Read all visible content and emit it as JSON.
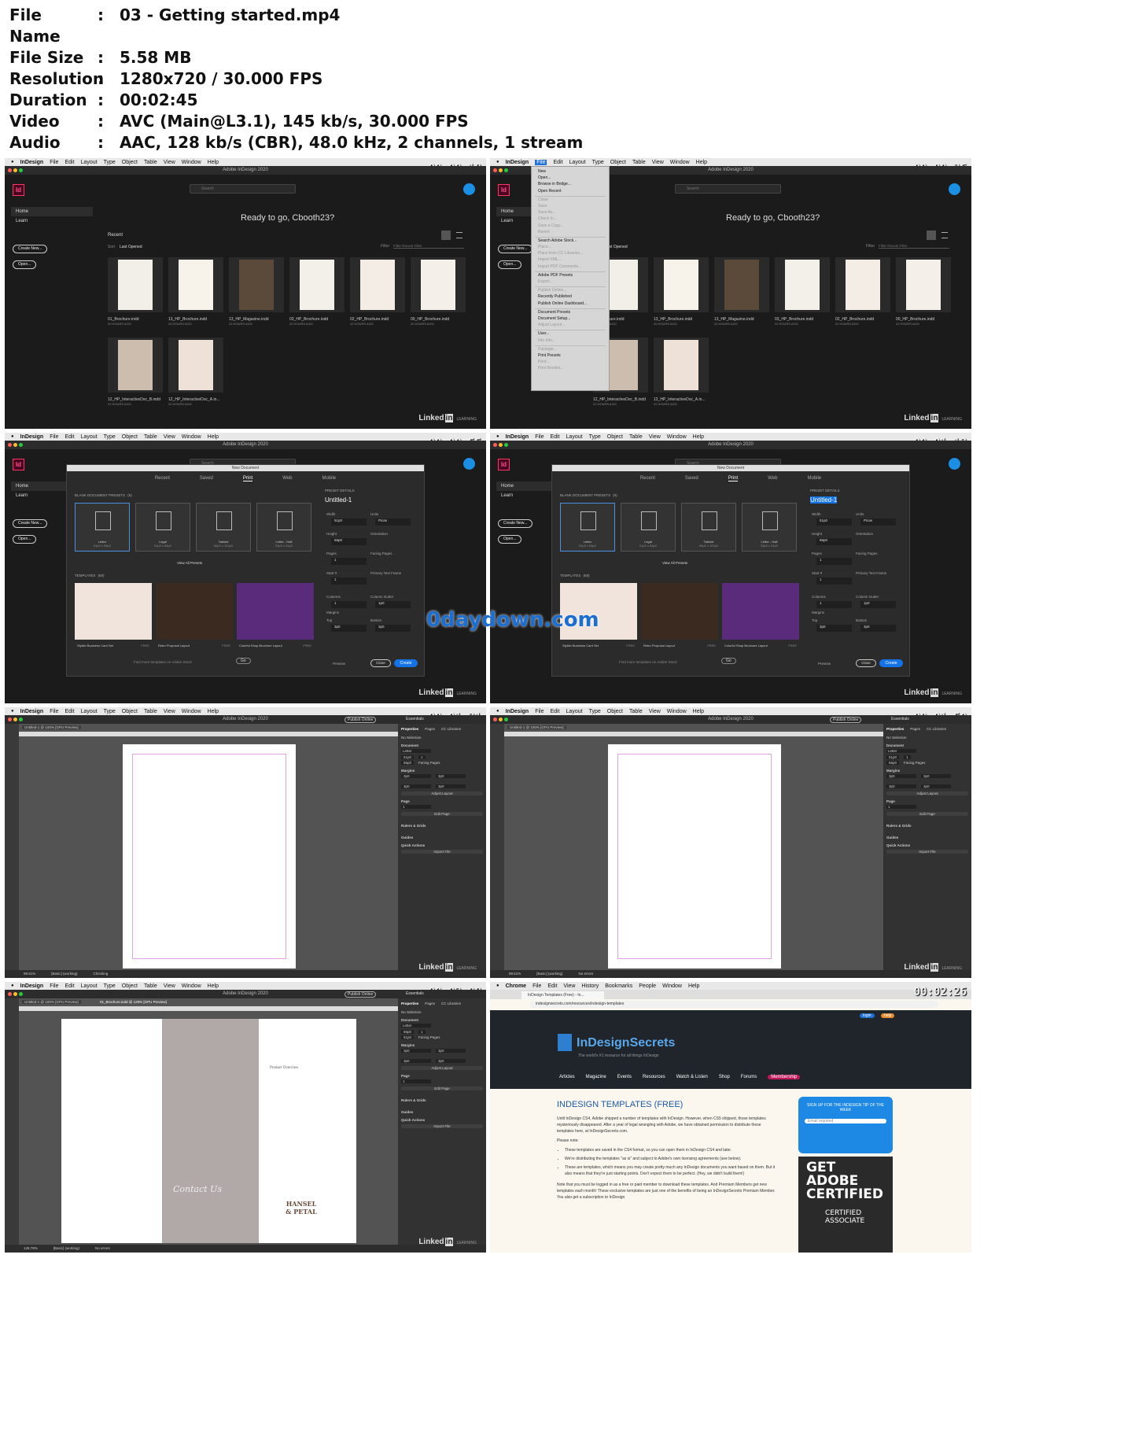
{
  "meta": [
    {
      "key": "File Name",
      "value": "03 - Getting started.mp4"
    },
    {
      "key": "File Size",
      "value": "5.58 MB"
    },
    {
      "key": "Resolution",
      "value": "1280x720 / 30.000 FPS"
    },
    {
      "key": "Duration",
      "value": "00:02:45"
    },
    {
      "key": "Video",
      "value": "AVC (Main@L3.1), 145 kb/s, 30.000 FPS"
    },
    {
      "key": "Audio",
      "value": "AAC, 128 kb/s (CBR), 48.0 kHz, 2 channels, 1 stream"
    }
  ],
  "sep": ":",
  "timestamps": [
    "00:00:18",
    "00:00:36",
    "00:00:55",
    "00:01:13",
    "00:01:31",
    "00:01:50",
    "00:02:08",
    "00:02:26"
  ],
  "mac_menu": {
    "app": "InDesign",
    "items": [
      "File",
      "Edit",
      "Layout",
      "Type",
      "Object",
      "Table",
      "View",
      "Window",
      "Help"
    ]
  },
  "chrome_menu": {
    "app": "Chrome",
    "items": [
      "File",
      "Edit",
      "View",
      "History",
      "Bookmarks",
      "People",
      "Window",
      "Help"
    ]
  },
  "window_title": "Adobe InDesign 2020",
  "app_logo": "Id",
  "search_placeholder": "Search",
  "home": {
    "sidebar": [
      "Home",
      "Learn"
    ],
    "create_new": "Create New...",
    "open": "Open...",
    "welcome": "Ready to go, Cbooth23?",
    "recent": "Recent",
    "sort_label": "Sort",
    "sort_value": "Last Opened",
    "filter_label": "Filter",
    "filter_placeholder": "Filter Recent Files",
    "files": [
      {
        "name": "01_Brochure.indd",
        "age": "20 HOURS AGO"
      },
      {
        "name": "13_HP_Brochure.indd",
        "age": "20 HOURS AGO"
      },
      {
        "name": "13_HP_Magazine.indd",
        "age": "22 HOURS AGO"
      },
      {
        "name": "03_HP_Brochure.indd",
        "age": "22 HOURS AGO"
      },
      {
        "name": "02_HP_Brochure.indd",
        "age": "22 HOURS AGO"
      },
      {
        "name": "00_HP_Brochure.indd",
        "age": "22 HOURS AGO"
      },
      {
        "name": "12_HP_InteractiveDoc_B.indd",
        "age": "22 HOURS AGO"
      },
      {
        "name": "12_HP_InteractiveDoc_A.in...",
        "age": "22 HOURS AGO"
      }
    ]
  },
  "file_menu": [
    {
      "t": "New",
      "d": false
    },
    {
      "t": "Open...",
      "d": false
    },
    {
      "t": "Browse in Bridge...",
      "d": false
    },
    {
      "t": "Open Recent",
      "d": false
    },
    {
      "t": "",
      "d": true
    },
    {
      "t": "Close",
      "d": true
    },
    {
      "t": "Save",
      "d": true
    },
    {
      "t": "Save As...",
      "d": true
    },
    {
      "t": "Check In...",
      "d": true
    },
    {
      "t": "Save a Copy...",
      "d": true
    },
    {
      "t": "Revert",
      "d": true
    },
    {
      "t": "",
      "d": true
    },
    {
      "t": "Search Adobe Stock...",
      "d": false
    },
    {
      "t": "Place...",
      "d": true
    },
    {
      "t": "Place from CC Libraries...",
      "d": true
    },
    {
      "t": "Import XML...",
      "d": true
    },
    {
      "t": "Import PDF Comments...",
      "d": true
    },
    {
      "t": "",
      "d": true
    },
    {
      "t": "Adobe PDF Presets",
      "d": false
    },
    {
      "t": "Export...",
      "d": true
    },
    {
      "t": "",
      "d": true
    },
    {
      "t": "Publish Online...",
      "d": true
    },
    {
      "t": "Recently Published",
      "d": false
    },
    {
      "t": "Publish Online Dashboard...",
      "d": false
    },
    {
      "t": "",
      "d": true
    },
    {
      "t": "Document Presets",
      "d": false
    },
    {
      "t": "Document Setup...",
      "d": false
    },
    {
      "t": "Adjust Layout...",
      "d": true
    },
    {
      "t": "",
      "d": true
    },
    {
      "t": "User...",
      "d": false
    },
    {
      "t": "File Info...",
      "d": true
    },
    {
      "t": "",
      "d": true
    },
    {
      "t": "Package...",
      "d": true
    },
    {
      "t": "Print Presets",
      "d": false
    },
    {
      "t": "Print...",
      "d": true
    },
    {
      "t": "Print Booklet...",
      "d": true
    }
  ],
  "new_doc": {
    "title": "New Document",
    "tabs": [
      "Recent",
      "Saved",
      "Print",
      "Web",
      "Mobile"
    ],
    "active_tab": "Print",
    "blank_header": "BLANK DOCUMENT PRESETS",
    "blank_count": "(9)",
    "presets": [
      {
        "name": "Letter",
        "size": "51p0 x 66p0"
      },
      {
        "name": "Legal",
        "size": "51p0 x 84p0"
      },
      {
        "name": "Tabloid",
        "size": "66p0 x 102p0"
      },
      {
        "name": "Letter - Half",
        "size": "33p0 x 51p0"
      }
    ],
    "view_all": "View All Presets",
    "templates_header": "TEMPLATES",
    "templates_count": "(68)",
    "templates": [
      {
        "name": "Stylish Business Card Set",
        "badge": "FREE"
      },
      {
        "name": "Retro Proposal Layout",
        "badge": "FREE"
      },
      {
        "name": "Colorful Shop Brochure Layout",
        "badge": "FREE"
      }
    ],
    "find_more": "Find more templates on Adobe Stock",
    "go": "Go",
    "preset_details": "PRESET DETAILS",
    "doc_name": "Untitled-1",
    "width_label": "Width",
    "width": "51p0",
    "units_label": "Units",
    "units": "Picas",
    "height_label": "Height",
    "height": "66p0",
    "orientation_label": "Orientation",
    "pages_label": "Pages",
    "pages": "1",
    "facing_label": "Facing Pages",
    "start_label": "Start #",
    "start": "1",
    "text_frame_label": "Primary Text Frame",
    "columns_label": "Columns",
    "columns": "1",
    "gutter_label": "Column Gutter",
    "gutter": "1p0",
    "margins_label": "Margins",
    "top_label": "Top",
    "top": "3p0",
    "bottom_label": "Bottom",
    "bottom": "3p0",
    "preview": "Preview",
    "close": "Close",
    "create": "Create"
  },
  "editor": {
    "publish": "Publish Online",
    "workspace": "Essentials",
    "tab1": "Untitled-1 @ 100% [GPU Preview]",
    "tab2": "01_Brochure.indd @ 129% [GPU Preview]",
    "panel_tabs": [
      "Properties",
      "Pages",
      "CC Libraries"
    ],
    "no_selection": "No Selection",
    "document": "Document",
    "preset": "Letter",
    "w": "51p0",
    "h": "66p0",
    "pages_count": "1",
    "facing": "Facing Pages",
    "margins": "Margins",
    "m_value": "3p0",
    "adjust_layout": "Adjust Layout",
    "page": "Page",
    "edit_page": "Edit Page",
    "rulers": "Rulers & Grids",
    "guides": "Guides",
    "quick_actions": "Quick Actions",
    "import_file": "Import File",
    "zoom1": "99.51%",
    "zoom2": "128.78%",
    "basic": "[Basic] (working)",
    "status_checking": "Checking",
    "status_noerr": "No errors",
    "contact_us": "Contact Us",
    "product_overview": "Product Overview",
    "hansel": "HANSEL & PETAL"
  },
  "watermark": "0daydown.com",
  "linkedin": {
    "brand": "Linked",
    "in": "in",
    "learning": "LEARNING"
  },
  "browser": {
    "tab": "InDesign Templates (Free) - In...",
    "url": "indesignsecrets.com/resources/indesign-templates",
    "login": "login",
    "help": "help",
    "site_name": "InDesignSecrets",
    "tagline": "The world's #1 resource for all things InDesign",
    "nav": [
      "Articles",
      "Magazine",
      "Events",
      "Resources",
      "Watch & Listen",
      "Shop",
      "Forums",
      "Membership"
    ],
    "heading": "INDESIGN TEMPLATES (FREE)",
    "p1": "Until InDesign CS4, Adobe shipped a number of templates with InDesign. However, when CS5 shipped, those templates mysteriously disappeared. After a year of legal wrangling with Adobe, we have obtained permission to distribute those templates here, at InDesignSecrets.com.",
    "note": "Please note:",
    "bullets": [
      "These templates are saved in the CS4 format, so you can open them in InDesign CS4 and later.",
      "We're distributing the templates \"as is\" and subject to Adobe's own licensing agreements (see below).",
      "These are templates, which means you may create pretty much any InDesign documents you want based on them. But it also means that they're just starting points. Don't expect them to be perfect. (Hey, we didn't build them!)"
    ],
    "p2": "Note that you must be logged in as a free or paid member to download these templates. And Premium Members get new templates each month! These exclusive templates are just one of the benefits of being an InDesignSecrets Premium Member. You also get a subscription to InDesign",
    "signup": "SIGN UP FOR THE INDESIGN TIP OF THE WEEK",
    "email_ph": "Email required",
    "go": "GO",
    "ad1": "GET",
    "ad2": "ADOBE",
    "ad3": "CERTIFIED",
    "ad4": "CERTIFIED",
    "ad5": "ASSOCIATE"
  },
  "colors": {
    "accent": "#1473e6",
    "id_brand": "#ff3366",
    "membership": "#c2185b"
  }
}
